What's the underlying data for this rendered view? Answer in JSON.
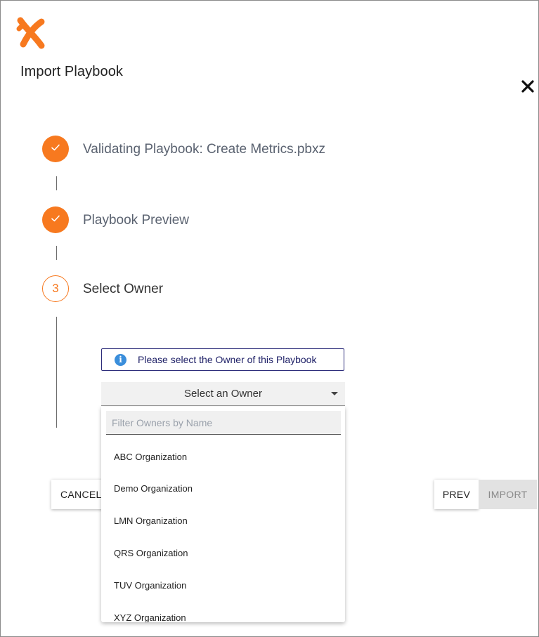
{
  "dialog": {
    "title": "Import Playbook",
    "close_icon": "close-icon",
    "logo_icon": "brand-logo"
  },
  "steps": [
    {
      "label": "Validating Playbook: Create Metrics.pbxz",
      "status": "complete",
      "icon": "check-icon"
    },
    {
      "label": "Playbook Preview",
      "status": "complete",
      "icon": "check-icon"
    },
    {
      "label": "Select Owner",
      "status": "active",
      "number": "3"
    }
  ],
  "owner_step": {
    "info_message": "Please select the Owner of this Playbook",
    "info_icon": "info-icon",
    "select_label": "Select an Owner",
    "filter_placeholder": "Filter Owners by Name",
    "filter_value": "",
    "options": [
      "ABC Organization",
      "Demo Organization",
      "LMN Organization",
      "QRS Organization",
      "TUV Organization",
      "XYZ Organization"
    ]
  },
  "actions": {
    "cancel_label": "CANCEL",
    "prev_label": "PREV",
    "import_label": "IMPORT",
    "import_enabled": false
  },
  "colors": {
    "accent": "#f7791f",
    "info": "#3a8edb",
    "info_border": "#2c2c7a"
  }
}
